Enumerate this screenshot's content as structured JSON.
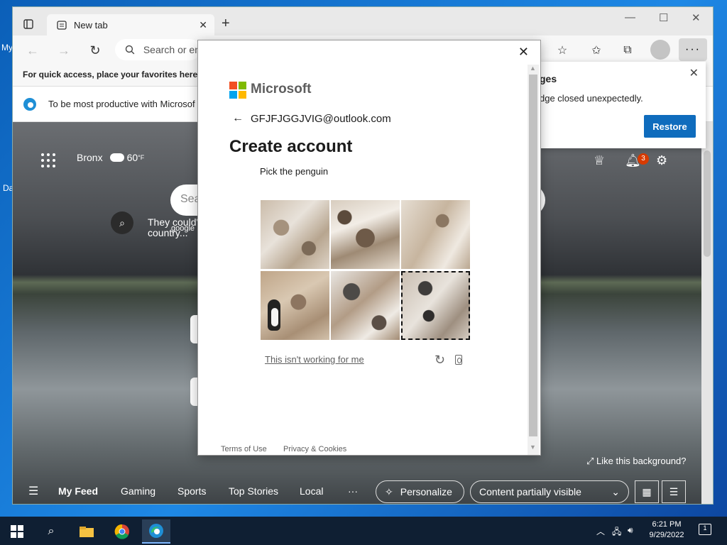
{
  "desktop": {
    "labels": [
      "My",
      "Da"
    ]
  },
  "browser": {
    "tab_title": "New tab",
    "address_placeholder": "Search or en",
    "favorites_bar_text": "For quick access, place your favorites here on",
    "info_bar_text": "To be most productive with Microsof",
    "ntp": {
      "location": "Bronx",
      "temperature": "60",
      "temperature_unit": "°F",
      "search_placeholder": "Sea",
      "trending_text": "They could'",
      "trending_text_2": "country...",
      "trending_source": "google",
      "notification_count": "3",
      "like_background": "Like this background?",
      "feed": {
        "items": [
          "My Feed",
          "Gaming",
          "Sports",
          "Top Stories",
          "Local"
        ],
        "more": "···",
        "personalize": "Personalize",
        "content_visibility": "Content partially visible"
      }
    }
  },
  "restore_popup": {
    "title": "ges",
    "message": "dge closed unexpectedly.",
    "button": "Restore"
  },
  "modal": {
    "brand": "Microsoft",
    "email": "GFJFJGGJVIG@outlook.com",
    "heading": "Create account",
    "instruction": "Pick the penguin",
    "not_working_link": "This isn't working for me",
    "terms_link": "Terms of Use",
    "privacy_link": "Privacy & Cookies"
  },
  "taskbar": {
    "time": "6:21 PM",
    "date": "9/29/2022",
    "notification_count": "1"
  },
  "colors": {
    "ms_red": "#f25022",
    "ms_green": "#7fba00",
    "ms_blue": "#00a4ef",
    "ms_yellow": "#ffb900",
    "primary_button": "#0f6cbd",
    "badge": "#d83b01"
  }
}
